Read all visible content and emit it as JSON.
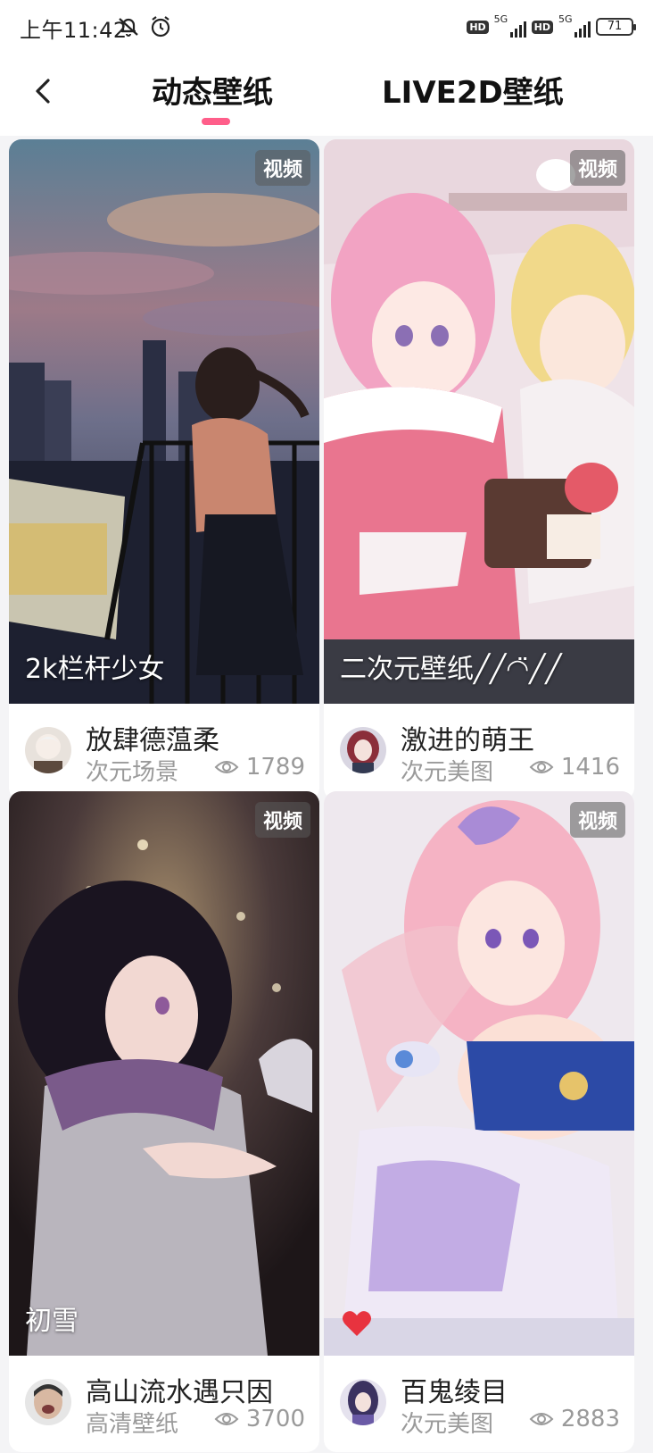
{
  "status_bar": {
    "time": "上午11:42",
    "network_1": "5G",
    "network_2": "5G",
    "hd_1": "HD",
    "hd_2": "HD",
    "battery": "71"
  },
  "header": {
    "tabs": [
      {
        "label": "动态壁纸",
        "active": true
      },
      {
        "label": "LIVE2D壁纸",
        "active": false
      }
    ],
    "accent_color": "#ff5e8a"
  },
  "cards": [
    {
      "badge": "视频",
      "caption": "2k栏杆少女",
      "author": "放肆德蕰柔",
      "category": "次元场景",
      "views": "1789"
    },
    {
      "badge": "视频",
      "caption": "二次元壁纸╱╱◠̈╱╱",
      "author": "激进的萌王",
      "category": "次元美图",
      "views": "1416"
    },
    {
      "badge": "视频",
      "caption": "初雪",
      "author": "高山流水遇只因",
      "category": "高清壁纸",
      "views": "3700"
    },
    {
      "badge": "视频",
      "caption": "",
      "author": "百鬼绫目",
      "category": "次元美图",
      "views": "2883"
    }
  ],
  "icons": {
    "back": "chevron-left-icon",
    "views": "eye-icon",
    "alarm": "alarm-icon",
    "mute": "bell-off-icon",
    "favorite": "heart-icon"
  }
}
